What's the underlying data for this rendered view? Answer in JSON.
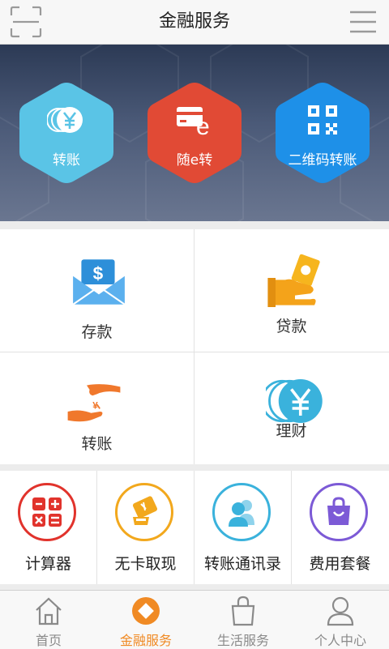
{
  "header": {
    "title": "金融服务"
  },
  "banner": {
    "items": [
      {
        "label": "转账",
        "color": "#5ac4e6"
      },
      {
        "label": "随e转",
        "color": "#e14a35"
      },
      {
        "label": "二维码转账",
        "color": "#1e90e8"
      }
    ]
  },
  "services": {
    "deposit": {
      "label": "存款"
    },
    "loan": {
      "label": "贷款"
    },
    "transfer": {
      "label": "转账"
    },
    "wealth": {
      "label": "理财"
    }
  },
  "tools": [
    {
      "label": "计算器",
      "color": "#e1332c"
    },
    {
      "label": "无卡取现",
      "color": "#f2a81d"
    },
    {
      "label": "转账通讯录",
      "color": "#3ab2dc"
    },
    {
      "label": "费用套餐",
      "color": "#7c5ad6"
    }
  ],
  "tabbar": {
    "items": [
      {
        "label": "首页",
        "icon": "home-icon"
      },
      {
        "label": "金融服务",
        "icon": "finance-icon"
      },
      {
        "label": "生活服务",
        "icon": "shopping-bag-icon"
      },
      {
        "label": "个人中心",
        "icon": "person-icon"
      }
    ],
    "active_index": 1,
    "active_color": "#f08a24"
  }
}
